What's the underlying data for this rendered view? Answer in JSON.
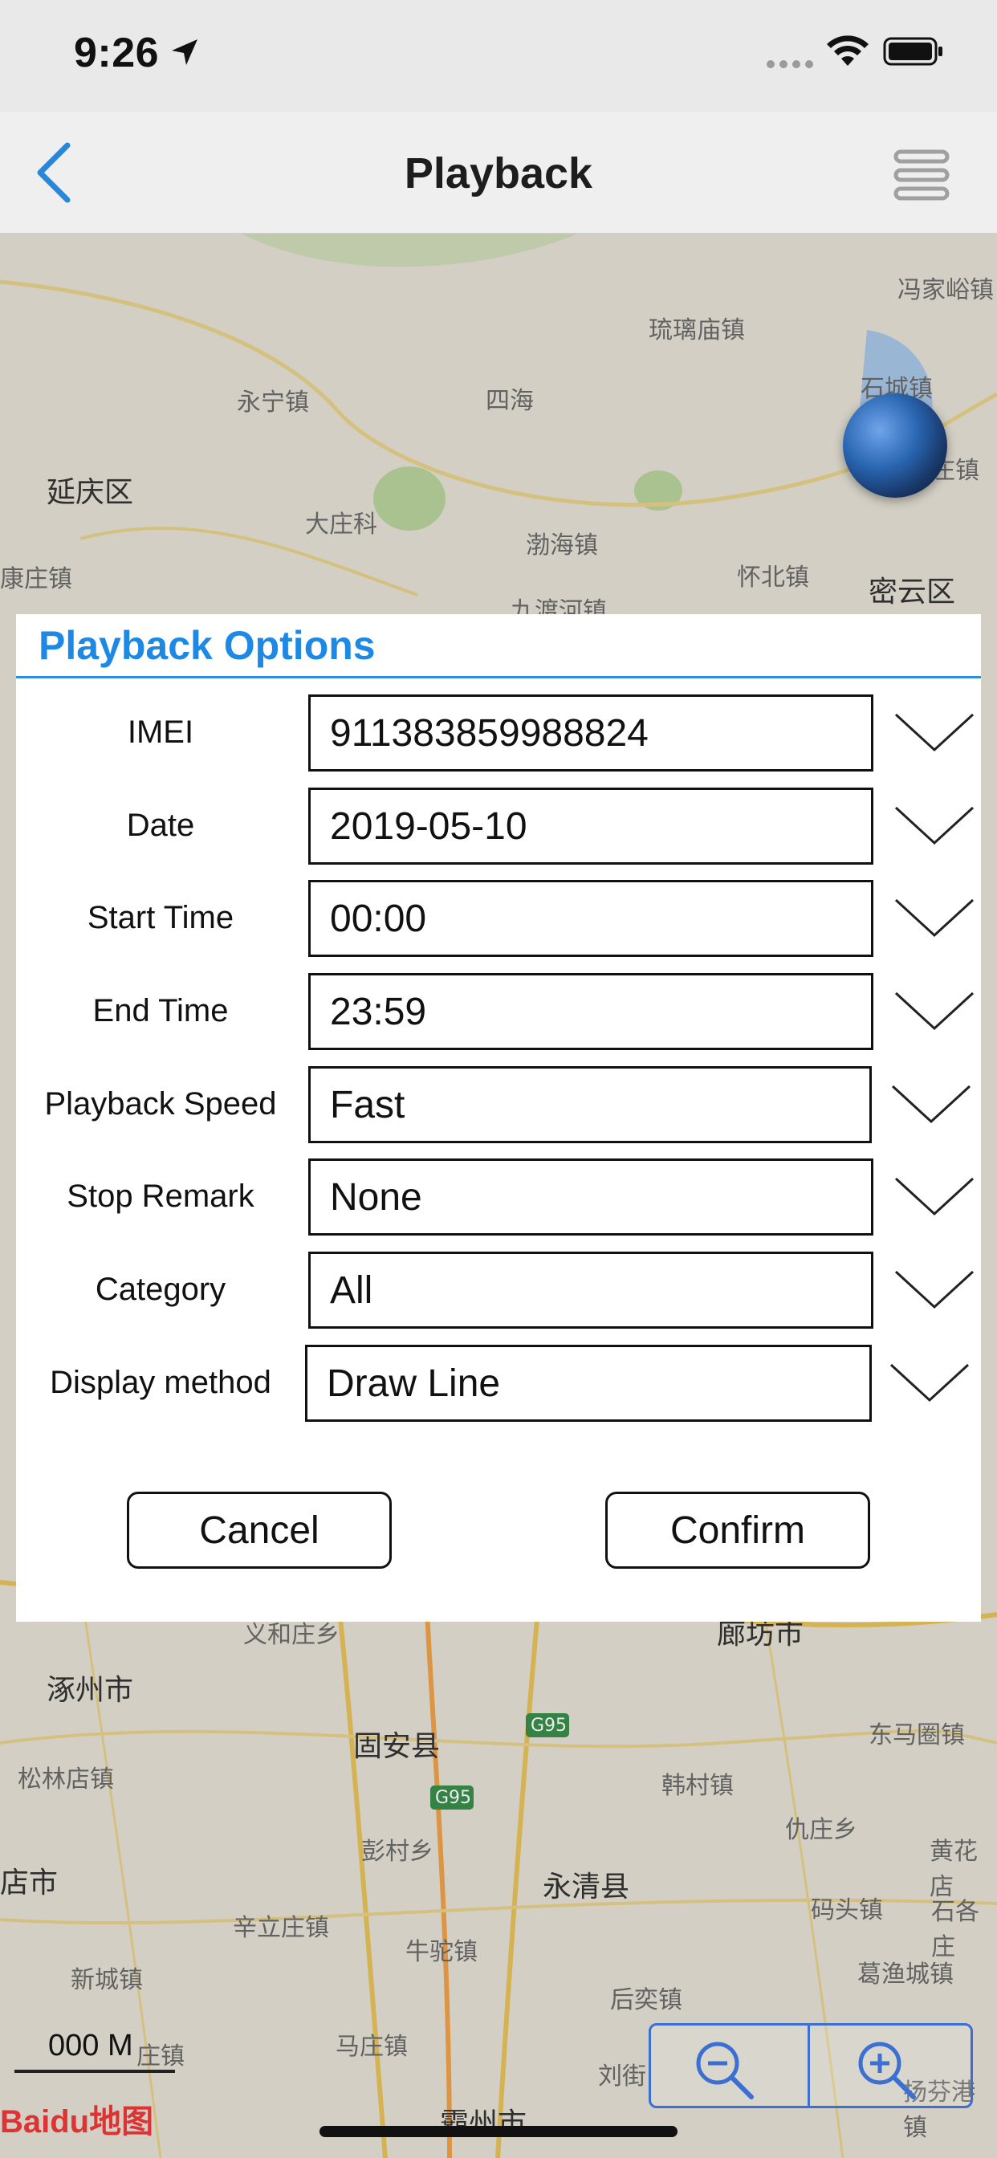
{
  "status_bar": {
    "time": "9:26",
    "icons": [
      "location-arrow-icon",
      "cellular-dots-icon",
      "wifi-icon",
      "battery-icon"
    ]
  },
  "nav": {
    "title": "Playback",
    "back_icon": "chevron-left-icon",
    "menu_icon": "hamburger-menu-icon"
  },
  "map": {
    "labels": [
      {
        "text": "冯家峪镇"
      },
      {
        "text": "琉璃庙镇"
      },
      {
        "text": "石城镇"
      },
      {
        "text": "永宁镇"
      },
      {
        "text": "四海"
      },
      {
        "text": "延庆区"
      },
      {
        "text": "大庄科"
      },
      {
        "text": "渤海镇"
      },
      {
        "text": "怀北镇"
      },
      {
        "text": "密云区"
      },
      {
        "text": "九渡河镇"
      },
      {
        "text": "康庄镇"
      },
      {
        "text": "庄镇"
      },
      {
        "text": "义和庄乡"
      },
      {
        "text": "廊坊市"
      },
      {
        "text": "涿州市"
      },
      {
        "text": "固安县"
      },
      {
        "text": "东马圈镇"
      },
      {
        "text": "松林店镇"
      },
      {
        "text": "韩村镇"
      },
      {
        "text": "彭村乡"
      },
      {
        "text": "仇庄乡"
      },
      {
        "text": "黄花店"
      },
      {
        "text": "店市"
      },
      {
        "text": "永清县"
      },
      {
        "text": "辛立庄镇"
      },
      {
        "text": "码头镇"
      },
      {
        "text": "石各庄"
      },
      {
        "text": "牛驼镇"
      },
      {
        "text": "新城镇"
      },
      {
        "text": "葛渔城镇"
      },
      {
        "text": "后奕镇"
      },
      {
        "text": "马庄镇"
      },
      {
        "text": "刘街"
      },
      {
        "text": "霸州市"
      },
      {
        "text": "扬芬港镇"
      },
      {
        "text": "庄镇"
      },
      {
        "text": "G95"
      },
      {
        "text": "G95"
      }
    ],
    "scale_label": "000 M",
    "logo_text": "Baidu地图",
    "zoom_out_icon": "zoom-out-icon",
    "zoom_in_icon": "zoom-in-icon"
  },
  "dialog": {
    "title": "Playback Options",
    "rows": [
      {
        "label": "IMEI",
        "value": "911383859988824"
      },
      {
        "label": "Date",
        "value": "2019-05-10"
      },
      {
        "label": "Start Time",
        "value": "00:00"
      },
      {
        "label": "End Time",
        "value": "23:59"
      },
      {
        "label": "Playback Speed",
        "value": "Fast"
      },
      {
        "label": "Stop Remark",
        "value": "None"
      },
      {
        "label": "Category",
        "value": "All"
      },
      {
        "label": "Display method",
        "value": "Draw Line"
      }
    ],
    "cancel_label": "Cancel",
    "confirm_label": "Confirm"
  },
  "colors": {
    "accent": "#1e88e5",
    "nav_back": "#2a87d8"
  }
}
